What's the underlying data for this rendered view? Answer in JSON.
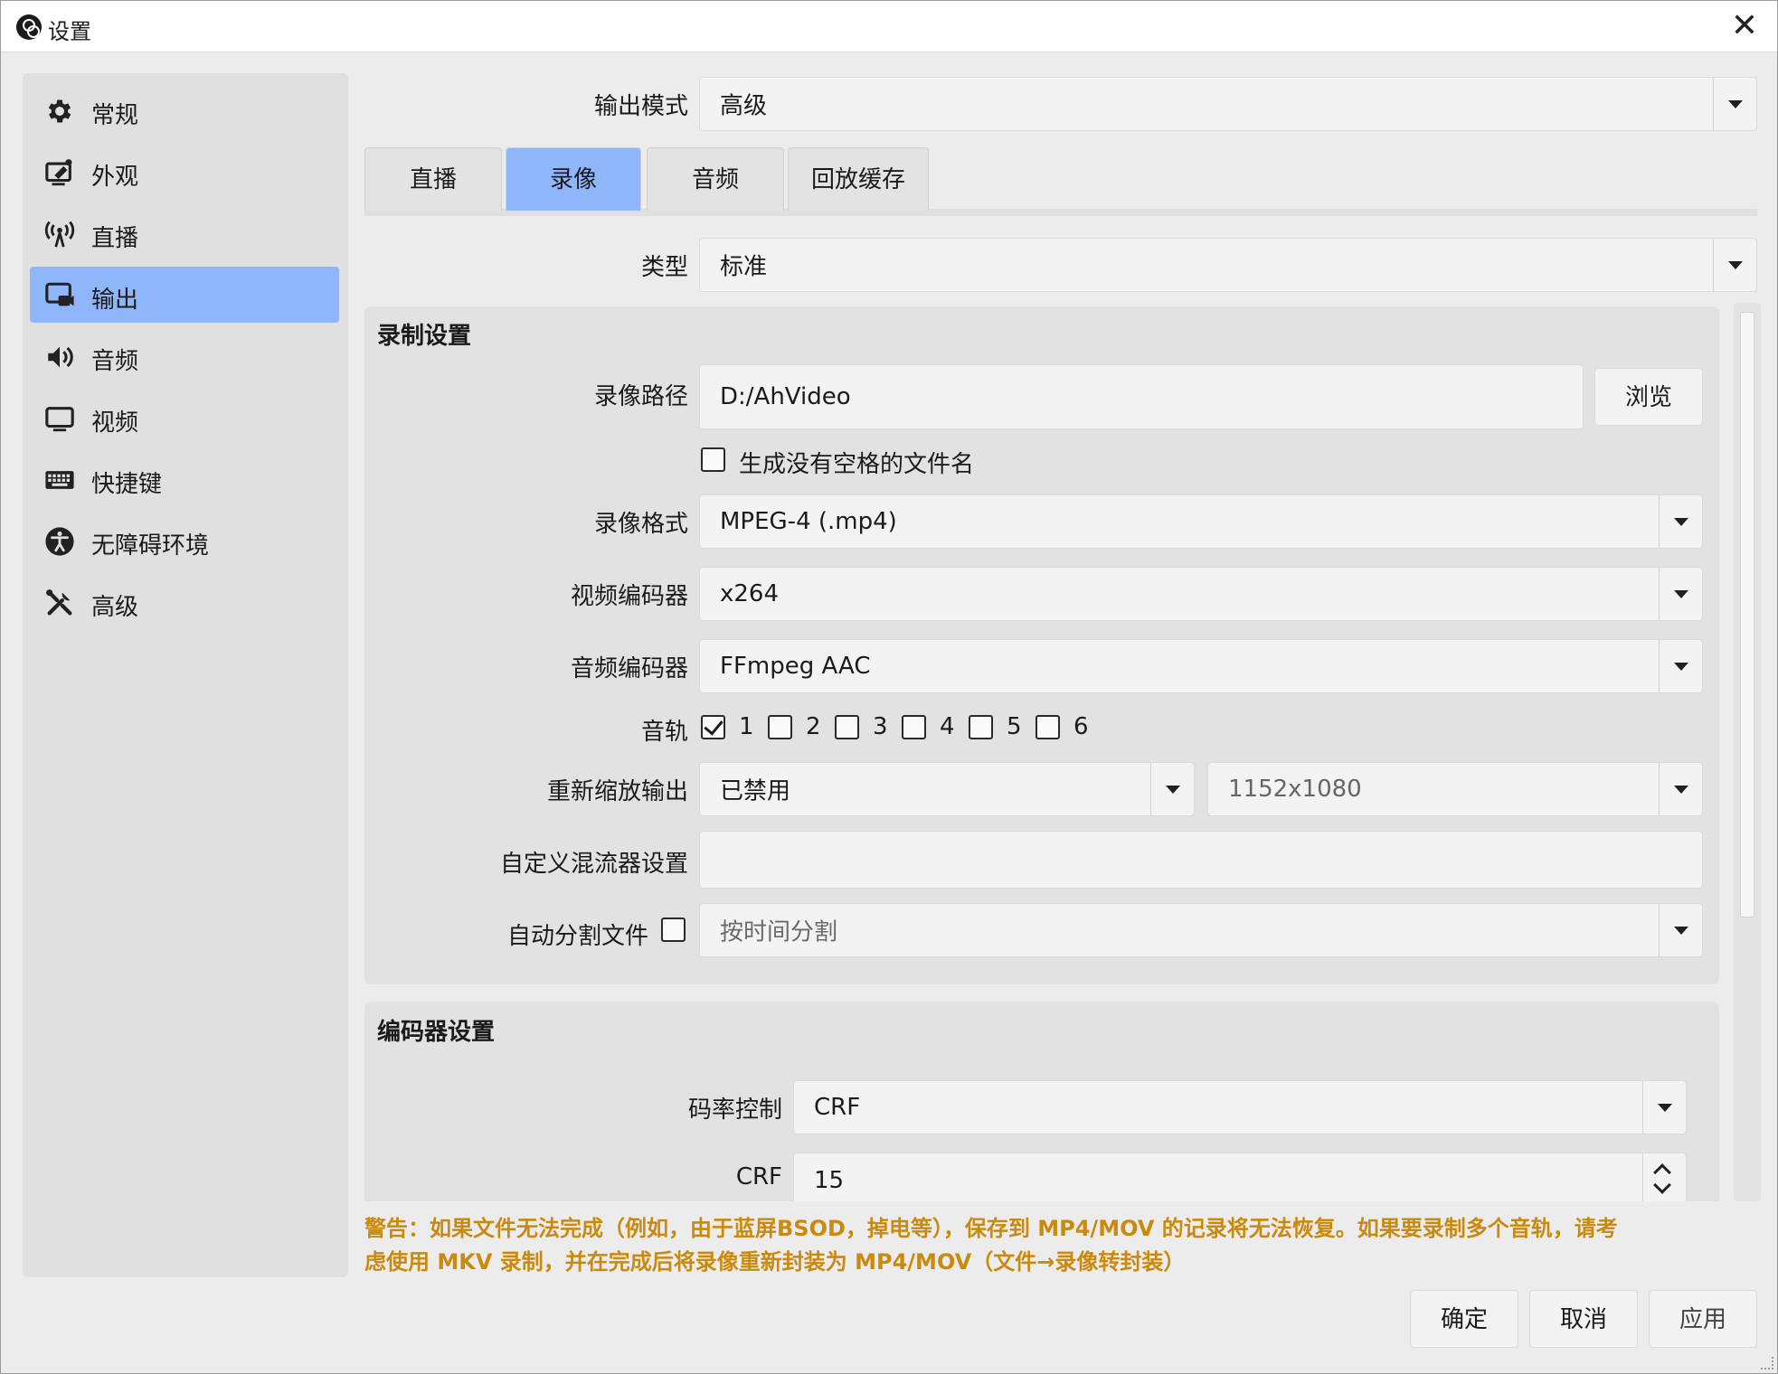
{
  "window": {
    "title": "设置",
    "close_glyph": "✕"
  },
  "sidebar": {
    "items": [
      {
        "label": "常规",
        "icon": "gear-icon"
      },
      {
        "label": "外观",
        "icon": "appearance-icon"
      },
      {
        "label": "直播",
        "icon": "antenna-icon"
      },
      {
        "label": "输出",
        "icon": "output-icon",
        "active": true
      },
      {
        "label": "音频",
        "icon": "speaker-icon"
      },
      {
        "label": "视频",
        "icon": "monitor-icon"
      },
      {
        "label": "快捷键",
        "icon": "keyboard-icon"
      },
      {
        "label": "无障碍环境",
        "icon": "accessibility-icon"
      },
      {
        "label": "高级",
        "icon": "tools-icon"
      }
    ]
  },
  "output_mode": {
    "label": "输出模式",
    "value": "高级"
  },
  "tabs": [
    {
      "label": "直播"
    },
    {
      "label": "录像",
      "active": true
    },
    {
      "label": "音频"
    },
    {
      "label": "回放缓存"
    }
  ],
  "type_row": {
    "label": "类型",
    "value": "标准"
  },
  "recording_settings": {
    "title": "录制设置",
    "path_label": "录像路径",
    "path_value": "D:/AhVideo",
    "browse_label": "浏览",
    "no_space_label": "生成没有空格的文件名",
    "no_space_checked": false,
    "format_label": "录像格式",
    "format_value": "MPEG-4 (.mp4)",
    "video_encoder_label": "视频编码器",
    "video_encoder_value": "x264",
    "audio_encoder_label": "音频编码器",
    "audio_encoder_value": "FFmpeg AAC",
    "audio_track_label": "音轨",
    "tracks": [
      {
        "label": "1",
        "checked": true
      },
      {
        "label": "2",
        "checked": false
      },
      {
        "label": "3",
        "checked": false
      },
      {
        "label": "4",
        "checked": false
      },
      {
        "label": "5",
        "checked": false
      },
      {
        "label": "6",
        "checked": false
      }
    ],
    "rescale_label": "重新缩放输出",
    "rescale_value": "已禁用",
    "rescale_resolution": "1152x1080",
    "muxer_label": "自定义混流器设置",
    "muxer_value": "",
    "split_label": "自动分割文件",
    "split_checked": false,
    "split_value": "按时间分割"
  },
  "encoder_settings": {
    "title": "编码器设置",
    "rate_control_label": "码率控制",
    "rate_control_value": "CRF",
    "crf_label": "CRF",
    "crf_value": "15"
  },
  "warning": {
    "line1": "警告：如果文件无法完成（例如，由于蓝屏BSOD，掉电等），保存到 MP4/MOV 的记录将无法恢复。如果要录制多个音轨，请考",
    "line2": "虑使用 MKV 录制，并在完成后将录像重新封装为 MP4/MOV（文件→录像转封装）",
    "color": "#c98a0e"
  },
  "buttons": {
    "ok": "确定",
    "cancel": "取消",
    "apply": "应用"
  },
  "colors": {
    "accent": "#8fb6fb"
  }
}
